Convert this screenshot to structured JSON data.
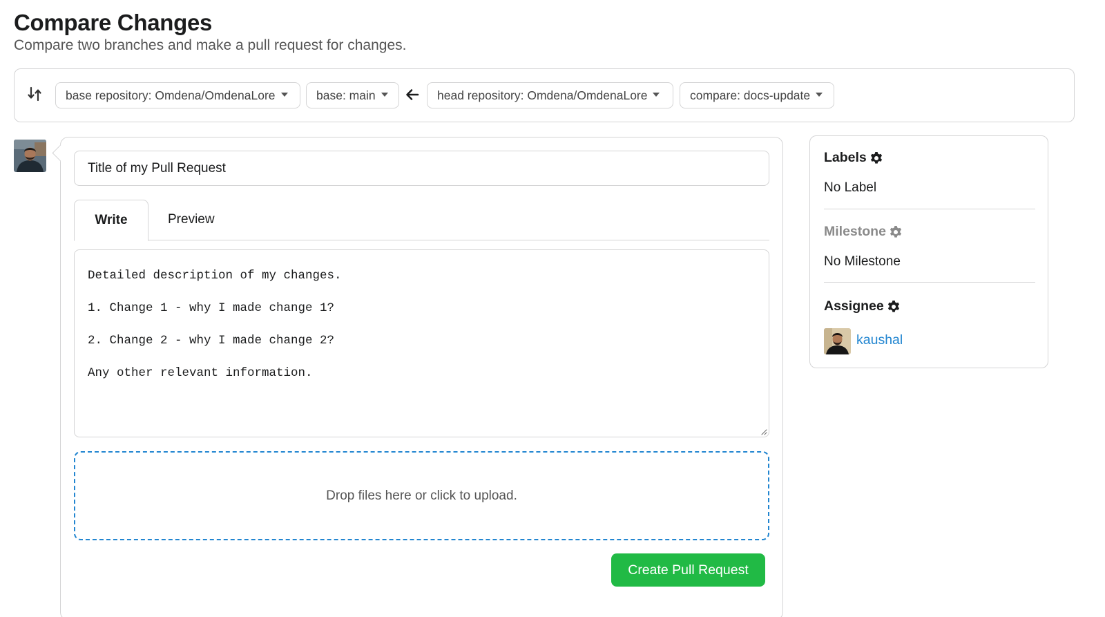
{
  "header": {
    "title": "Compare Changes",
    "subtitle": "Compare two branches and make a pull request for changes."
  },
  "compare": {
    "icon": "git-compare-icon",
    "base_repository": "base repository: Omdena/OmdenaLore",
    "base_branch": "base: main",
    "direction_icon": "arrow-left-icon",
    "head_repository": "head repository: Omdena/OmdenaLore",
    "compare_branch": "compare: docs-update"
  },
  "form": {
    "title_value": "Title of my Pull Request",
    "tabs": [
      {
        "label": "Write",
        "active": true
      },
      {
        "label": "Preview",
        "active": false
      }
    ],
    "description": "Detailed description of my changes.\n1. Change 1 - why I made change 1?\n2. Change 2 - why I made change 2?\nAny other relevant information.",
    "dropzone_text": "Drop files here or click to upload.",
    "submit_label": "Create Pull Request"
  },
  "sidebar": {
    "labels": {
      "heading": "Labels",
      "value": "No Label",
      "icon": "gear-icon"
    },
    "milestone": {
      "heading": "Milestone",
      "value": "No Milestone",
      "icon": "gear-icon"
    },
    "assignee": {
      "heading": "Assignee",
      "name": "kaushal",
      "icon": "gear-icon"
    }
  },
  "colors": {
    "accent_blue": "#2185d0",
    "success_green": "#21ba45",
    "border": "#d4d4d5",
    "muted_text": "#8a8a8a"
  }
}
